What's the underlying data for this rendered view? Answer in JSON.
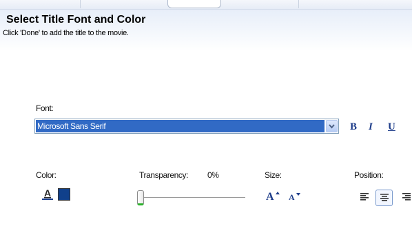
{
  "header": {
    "title": "Select Title Font and Color",
    "subtitle": "Click 'Done' to add the title to the movie."
  },
  "font": {
    "label": "Font:",
    "selected": "Microsoft Sans Serif"
  },
  "format": {
    "bold_label": "B",
    "italic_label": "I",
    "underline_label": "U"
  },
  "color": {
    "label": "Color:",
    "text_color_icon": "font-color-icon",
    "selected_color": "#10408b"
  },
  "transparency": {
    "label": "Transparency:",
    "value": "0%",
    "level": 0
  },
  "size": {
    "label": "Size:",
    "increase_icon": "increase-font-size-icon",
    "decrease_icon": "decrease-font-size-icon"
  },
  "position": {
    "label": "Position:",
    "options": [
      "align-left-icon",
      "align-center-icon",
      "align-right-icon"
    ],
    "selected": "align-center-icon"
  },
  "colors": {
    "header_gradient_top": "#e7eef9",
    "selection_blue": "#316ac5",
    "format_button_blue": "#1e3d8a",
    "slider_accent": "#2bb02b"
  }
}
